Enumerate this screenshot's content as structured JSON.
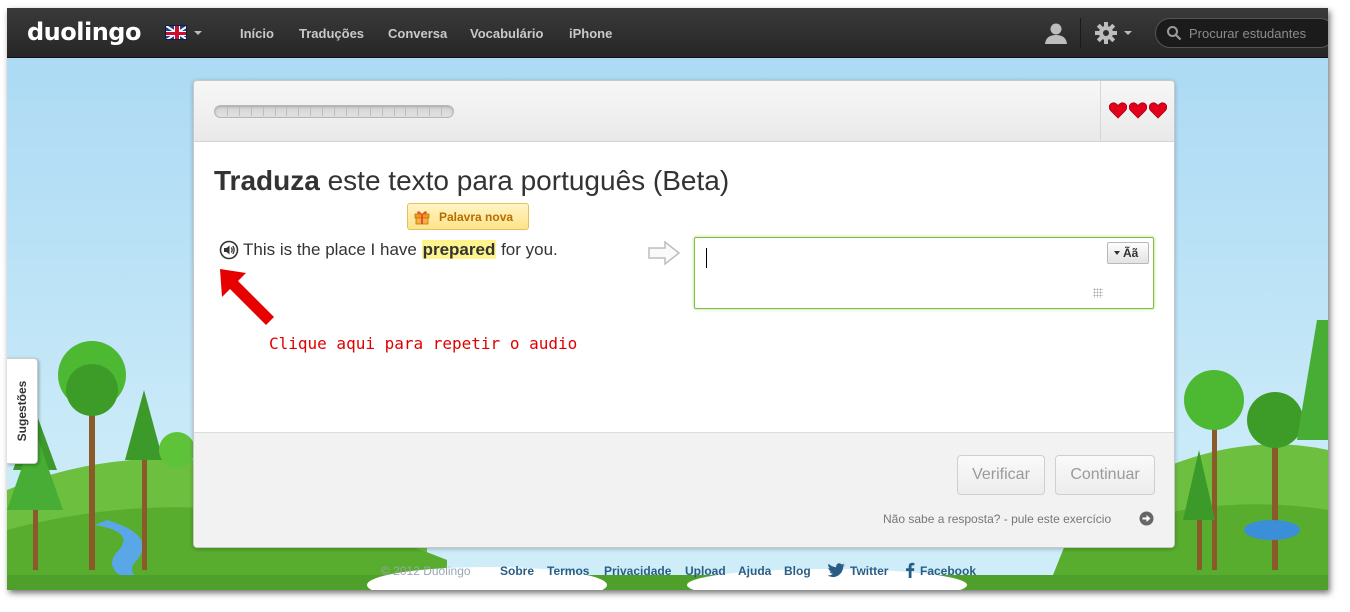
{
  "app": {
    "logo": "duolingo",
    "language_flag": "uk-flag-icon"
  },
  "nav": {
    "items": [
      "Início",
      "Traduções",
      "Conversa",
      "Vocabulário",
      "iPhone"
    ]
  },
  "search": {
    "placeholder": "Procurar estudantes"
  },
  "sidebar": {
    "suggestions_label": "Sugestões"
  },
  "lesson": {
    "hearts": 3,
    "progress_segments": 20,
    "progress_filled": 0,
    "title_bold": "Traduza",
    "title_rest": " este texto para português (Beta)",
    "new_word_label": "Palavra nova",
    "sentence_before": "This is the place I have ",
    "sentence_highlight": "prepared",
    "sentence_after": " for you.",
    "hint": "Clique aqui para repetir o audio",
    "answer_value": "",
    "accent_button": "Ãã",
    "verify_button": "Verificar",
    "continue_button": "Continuar",
    "skip_text": "Não sabe a resposta? - pule este exercício"
  },
  "footer": {
    "copyright": "© 2012 Duolingo",
    "links": [
      "Sobre",
      "Termos",
      "Privacidade",
      "Upload",
      "Ajuda",
      "Blog",
      "Twitter",
      "Facebook"
    ]
  },
  "colors": {
    "accent_green": "#7fc03a",
    "heart_red": "#e3001b",
    "hint_red": "#e00000",
    "highlight_yellow": "#fef48c",
    "link_blue": "#2a5d85"
  }
}
